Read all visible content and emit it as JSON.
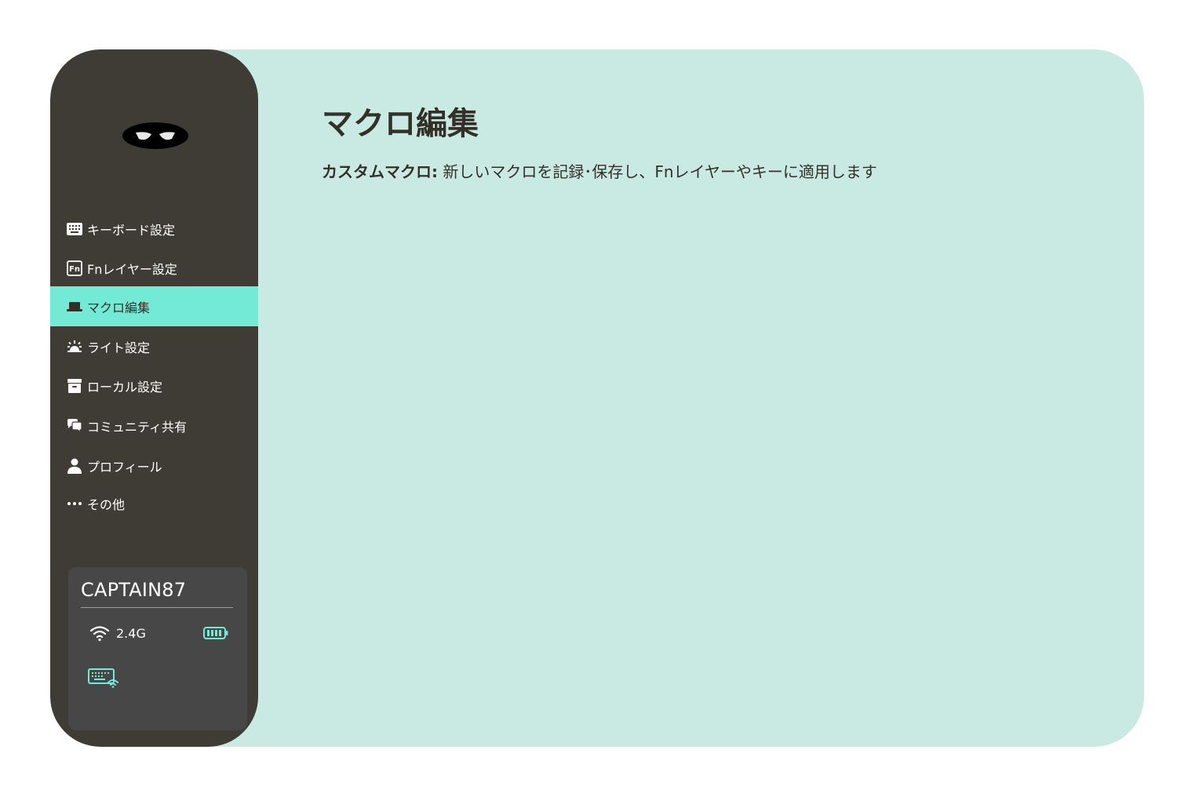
{
  "sidebar": {
    "logo": "mask-logo",
    "items": [
      {
        "label": "キーボード設定",
        "icon": "keyboard-icon",
        "active": false
      },
      {
        "label": "Fnレイヤー設定",
        "icon": "fn-key-icon",
        "active": false
      },
      {
        "label": "マクロ編集",
        "icon": "laptop-icon",
        "active": true
      },
      {
        "label": "ライト設定",
        "icon": "sunrise-icon",
        "active": false
      },
      {
        "label": "ローカル設定",
        "icon": "archive-box-icon",
        "active": false
      },
      {
        "label": "コミュニティ共有",
        "icon": "chat-bubbles-icon",
        "active": false
      },
      {
        "label": "プロフィール",
        "icon": "user-icon",
        "active": false
      },
      {
        "label": "その他",
        "icon": "more-dots-icon",
        "active": false
      }
    ]
  },
  "device": {
    "name": "CAPTAIN87",
    "connection": "2.4G",
    "connection_icon": "wifi-icon",
    "battery_icon": "battery-full-icon",
    "mode_icon": "wireless-keyboard-icon"
  },
  "main": {
    "title": "マクロ編集",
    "description_lead": "カスタムマクロ:",
    "description_text": " 新しいマクロを記録･保存し、Fnレイヤーやキーに適用します"
  },
  "colors": {
    "background": "#c9e9e3",
    "sidebar": "#3e3c35",
    "active": "#72ead6",
    "card": "#474747",
    "text_dark": "#333028",
    "accent_icon": "#72ead6"
  }
}
